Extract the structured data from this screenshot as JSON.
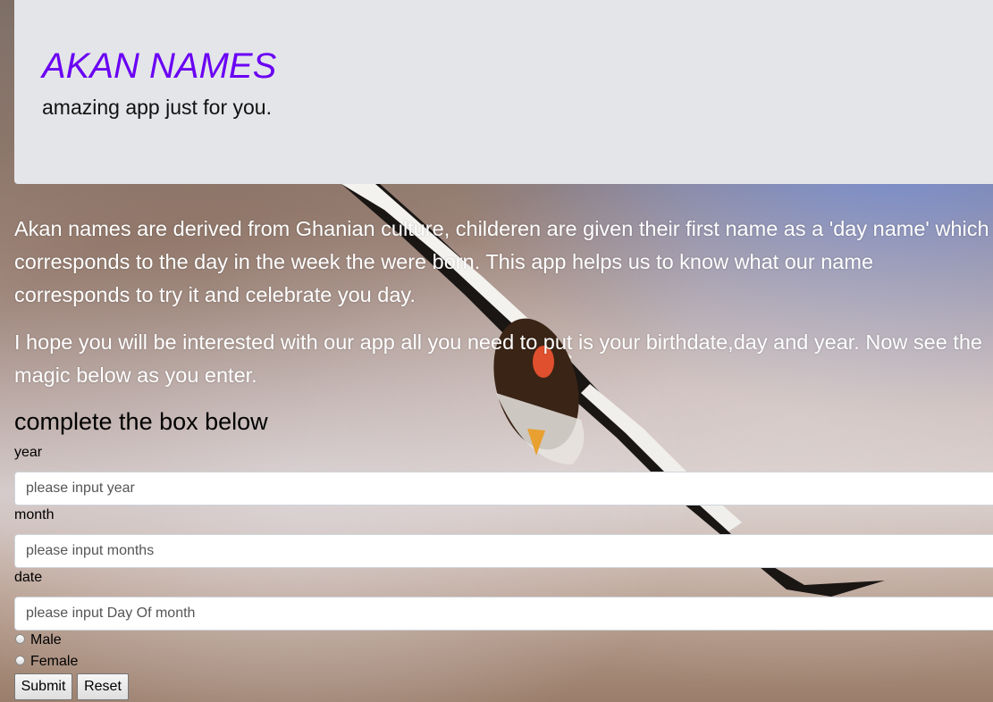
{
  "header": {
    "title": "AKAN NAMES",
    "subtitle": "amazing app just for you."
  },
  "intro": {
    "paragraph1": "Akan names are derived from Ghanian culture, childeren are given their first name as a 'day name' which corresponds to the day in the week the were born. This app helps us to know what our name corresponds to try it and celebrate you day.",
    "paragraph2": "I hope you will be interested with our app all you need to put is your birthdate,day and year. Now see the magic below as you enter."
  },
  "form": {
    "heading": "complete the box below",
    "year": {
      "label": "year",
      "placeholder": "please input year"
    },
    "month": {
      "label": "month",
      "placeholder": "please input months"
    },
    "date": {
      "label": "date",
      "placeholder": "please input Day Of month"
    },
    "gender_options": [
      "Male",
      "Female"
    ],
    "submit_label": "Submit",
    "reset_label": "Reset"
  },
  "colors": {
    "title": "#6a00f4",
    "header_background": "#e4e5e9"
  }
}
